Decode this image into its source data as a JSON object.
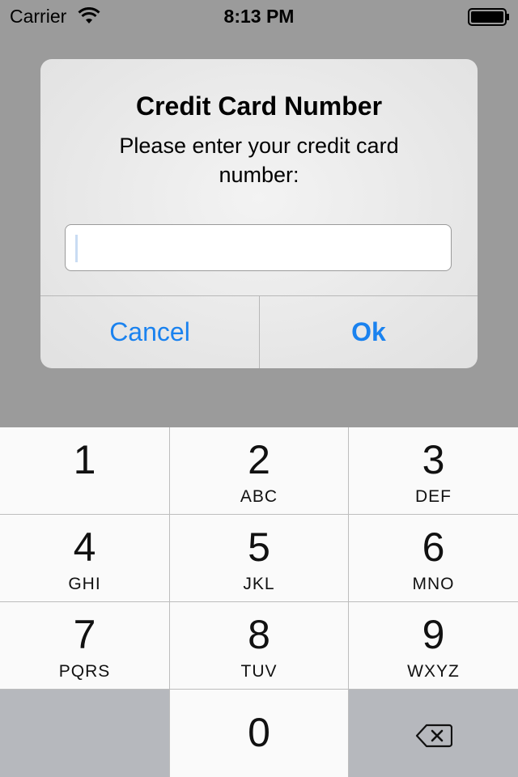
{
  "status_bar": {
    "carrier": "Carrier",
    "time": "8:13 PM",
    "icons": [
      "wifi-icon",
      "battery-icon"
    ]
  },
  "alert": {
    "title": "Credit Card Number",
    "message": "Please enter your credit card number:",
    "input_value": "",
    "buttons": {
      "cancel": "Cancel",
      "ok": "Ok"
    },
    "accent_color": "#1a82ef"
  },
  "keypad": {
    "keys": [
      {
        "digit": "1",
        "letters": ""
      },
      {
        "digit": "2",
        "letters": "ABC"
      },
      {
        "digit": "3",
        "letters": "DEF"
      },
      {
        "digit": "4",
        "letters": "GHI"
      },
      {
        "digit": "5",
        "letters": "JKL"
      },
      {
        "digit": "6",
        "letters": "MNO"
      },
      {
        "digit": "7",
        "letters": "PQRS"
      },
      {
        "digit": "8",
        "letters": "TUV"
      },
      {
        "digit": "9",
        "letters": "WXYZ"
      },
      {
        "digit": "0",
        "letters": ""
      }
    ],
    "delete_icon": "backspace-icon"
  }
}
